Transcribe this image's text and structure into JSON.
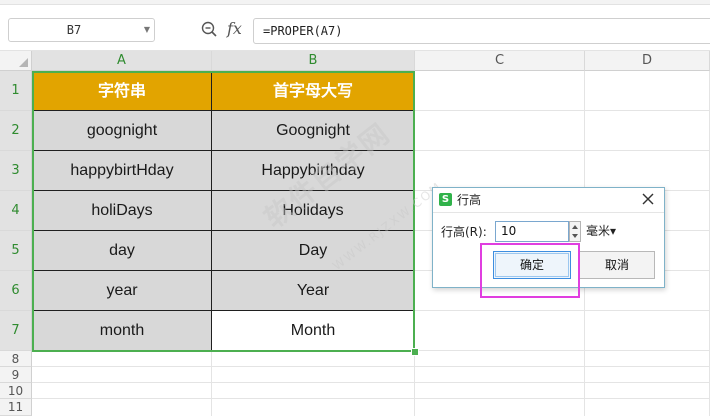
{
  "formula_bar": {
    "name_box": "B7",
    "fx_label": "fx",
    "formula": "=PROPER(A7)"
  },
  "columns": [
    "A",
    "B",
    "C",
    "D"
  ],
  "rows": [
    "1",
    "2",
    "3",
    "4",
    "5",
    "6",
    "7",
    "8",
    "9",
    "10",
    "11"
  ],
  "table": {
    "header": [
      "字符串",
      "首字母大写"
    ],
    "data": [
      [
        "goognight",
        "Goognight"
      ],
      [
        "happybirtHday",
        "Happybirthday"
      ],
      [
        "holiDays",
        "Holidays"
      ],
      [
        "day",
        "Day"
      ],
      [
        "year",
        "Year"
      ],
      [
        "month",
        "Month"
      ]
    ]
  },
  "watermark": {
    "text": "软件自学网",
    "sub": "WWW.RJZXW.COM"
  },
  "dialog": {
    "icon_letter": "S",
    "title": "行高",
    "row_height_label": "行高(R):",
    "row_height_value": "10",
    "unit": "毫米▾",
    "ok": "确定",
    "cancel": "取消"
  },
  "colors": {
    "header_fill": "#e2a400",
    "body_fill": "#d8d8d8",
    "selection": "#4caf50",
    "highlight": "#e03ee0"
  }
}
